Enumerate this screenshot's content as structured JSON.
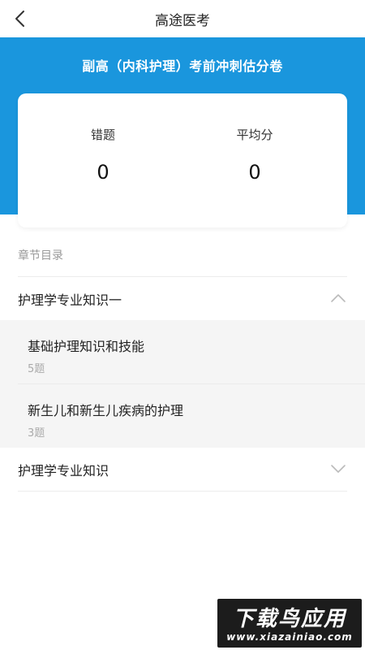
{
  "header": {
    "title": "高途医考"
  },
  "banner": {
    "title": "副高（内科护理）考前冲刺估分卷"
  },
  "stats": {
    "wrong_label": "错题",
    "wrong_value": "0",
    "avg_label": "平均分",
    "avg_value": "0"
  },
  "catalog": {
    "section_label": "章节目录",
    "chapters": [
      {
        "title": "护理学专业知识一",
        "expanded": true,
        "items": [
          {
            "title": "基础护理知识和技能",
            "count": "5题"
          },
          {
            "title": "新生儿和新生儿疾病的护理",
            "count": "3题"
          }
        ]
      },
      {
        "title": "护理学专业知识",
        "expanded": false,
        "items": []
      }
    ]
  },
  "watermark": {
    "main": "下载鸟应用",
    "url": "www.xiazainiao.com"
  },
  "colors": {
    "brand_blue": "#1a96dd",
    "panel_gray": "#f5f5f5"
  },
  "icons": {
    "back": "chevron-left-icon",
    "expand": "chevron-up-icon",
    "collapse": "chevron-down-icon"
  }
}
